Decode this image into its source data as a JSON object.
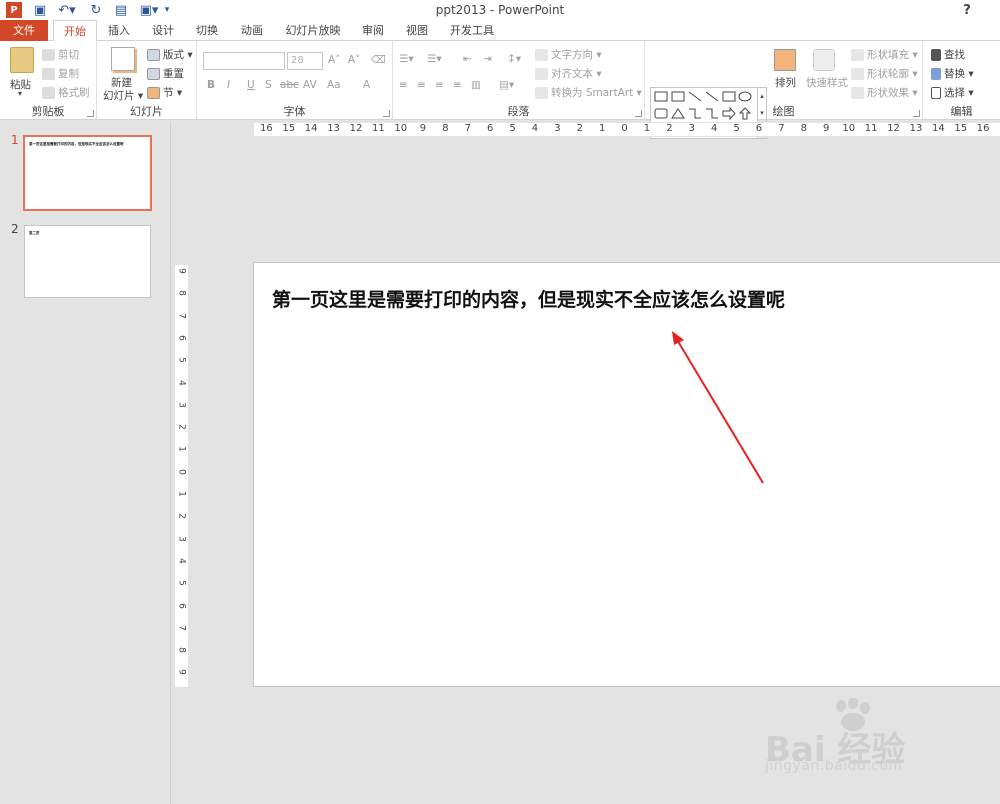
{
  "titlebar": {
    "title": "ppt2013 - PowerPoint",
    "help": "?"
  },
  "tabs": [
    "文件",
    "开始",
    "插入",
    "设计",
    "切换",
    "动画",
    "幻灯片放映",
    "审阅",
    "视图",
    "开发工具"
  ],
  "groups": {
    "clipboard": {
      "label": "剪贴板",
      "paste": "粘贴",
      "cut": "剪切",
      "copy": "复制",
      "format_painter": "格式刷"
    },
    "slides": {
      "label": "幻灯片",
      "new_slide_1": "新建",
      "new_slide_2": "幻灯片 ▾",
      "layout": "版式 ▾",
      "reset": "重置",
      "section": "节 ▾"
    },
    "font": {
      "label": "字体",
      "font_size": "28",
      "bold": "B",
      "italic": "I",
      "underline": "U",
      "strike": "S",
      "abc": "abc",
      "spacing": "AV",
      "case": "Aa",
      "color": "A",
      "grow": "A˄",
      "shrink": "A˅"
    },
    "paragraph": {
      "label": "段落",
      "text_direction": "文字方向 ▾",
      "align_text": "对齐文本 ▾",
      "smartart": "转换为 SmartArt ▾"
    },
    "drawing": {
      "label": "绘图",
      "arrange": "排列",
      "quick_styles": "快速样式",
      "fill": "形状填充 ▾",
      "outline": "形状轮廓 ▾",
      "effects": "形状效果 ▾"
    },
    "editing": {
      "label": "编辑",
      "find": "查找",
      "replace": "替换 ▾",
      "select": "选择 ▾"
    }
  },
  "ruler_h": [
    "16",
    "15",
    "14",
    "13",
    "12",
    "11",
    "10",
    "9",
    "8",
    "7",
    "6",
    "5",
    "4",
    "3",
    "2",
    "1",
    "0",
    "1",
    "2",
    "3",
    "4",
    "5",
    "6",
    "7",
    "8",
    "9",
    "10",
    "11",
    "12",
    "13",
    "14",
    "15",
    "16"
  ],
  "ruler_v": [
    "9",
    "8",
    "7",
    "6",
    "5",
    "4",
    "3",
    "2",
    "1",
    "0",
    "1",
    "2",
    "3",
    "4",
    "5",
    "6",
    "7",
    "8",
    "9"
  ],
  "thumbnails": [
    {
      "num": "1",
      "text": "第一页这里是需要打印的内容，但是现实不全应该怎么设置呢"
    },
    {
      "num": "2",
      "text": "第二页"
    }
  ],
  "slide": {
    "text": "第一页这里是需要打印的内容，但是现实不全应该怎么设置呢"
  },
  "watermark": {
    "main": "Bai 经验",
    "sub": "jingyan.baidu.com"
  },
  "colors": {
    "accent": "#d24726",
    "arrow": "#e52222",
    "selection": "#e97158"
  }
}
